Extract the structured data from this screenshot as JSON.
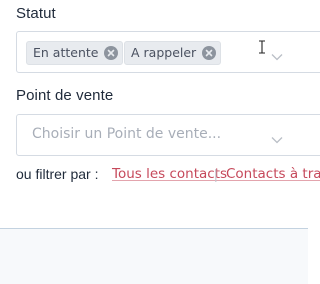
{
  "statut": {
    "label": "Statut",
    "tags": [
      {
        "label": "En attente",
        "remove_icon": "close-circle-icon"
      },
      {
        "label": "A rappeler",
        "remove_icon": "close-circle-icon"
      }
    ],
    "dropdown_icon": "chevron-down-icon",
    "cursor_icon": "text-cursor-icon"
  },
  "point_de_vente": {
    "label": "Point de vente",
    "placeholder": "Choisir un Point de vente...",
    "dropdown_icon": "chevron-down-icon"
  },
  "filters": {
    "label": "ou filtrer par :",
    "links": [
      {
        "label": "Tous les contacts"
      },
      {
        "label": "Contacts à trait"
      }
    ],
    "separator": "|"
  },
  "colors": {
    "link": "#c6495b",
    "text": "#1f2a3a",
    "placeholder": "#a8aeb8",
    "tag_bg": "#e8ebef",
    "border": "#d5dbe3"
  }
}
